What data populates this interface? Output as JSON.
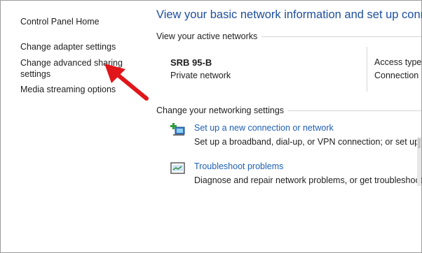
{
  "sidebar": {
    "items": [
      {
        "label": "Control Panel Home"
      },
      {
        "label": "Change adapter settings"
      },
      {
        "label": "Change advanced sharing settings"
      },
      {
        "label": "Media streaming options"
      }
    ]
  },
  "main": {
    "title": "View your basic network information and set up conne",
    "active_networks_label": "View your active networks",
    "network": {
      "name": "SRB 95-B",
      "type": "Private network",
      "access_type_label": "Access type:",
      "connections_label": "Connection"
    },
    "change_settings_label": "Change your networking settings",
    "tasks": [
      {
        "icon": "new-connection-icon",
        "link": "Set up a new connection or network",
        "desc": "Set up a broadband, dial-up, or VPN connection; or set up a r"
      },
      {
        "icon": "troubleshoot-icon",
        "link": "Troubleshoot problems",
        "desc": "Diagnose and repair network problems, or get troubleshooting"
      }
    ]
  },
  "colors": {
    "title": "#1e4fa0",
    "link": "#1e5fb4",
    "annotation_arrow": "#e0161b"
  }
}
